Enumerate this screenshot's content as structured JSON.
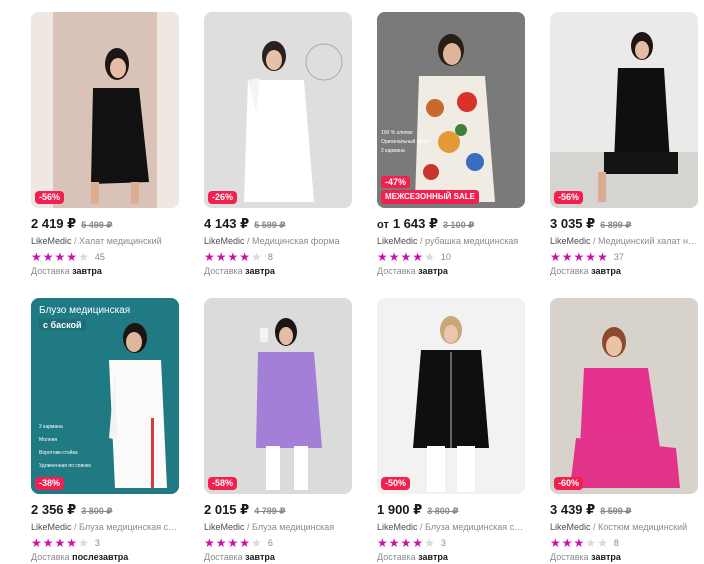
{
  "products": [
    {
      "discount": "-56%",
      "prefix": "",
      "price": "2 419 ₽",
      "old_price": "5 499 ₽",
      "brand": "LikeMedic",
      "name": " / Халат медицинский",
      "stars": 4,
      "reviews": "45",
      "delivery_label": "Доставка",
      "delivery_day": "завтра"
    },
    {
      "discount": "-26%",
      "prefix": "",
      "price": "4 143 ₽",
      "old_price": "5 599 ₽",
      "brand": "LikeMedic",
      "name": " / Медицинская форма",
      "stars": 4,
      "reviews": "8",
      "delivery_label": "Доставка",
      "delivery_day": "завтра"
    },
    {
      "discount": "-47%",
      "promo": "МЕЖСЕЗОННЫЙ SALE",
      "features": [
        "100 % хлопок",
        "Оригинальный принт",
        "2 кармана"
      ],
      "prefix": "от",
      "price": "1 643 ₽",
      "old_price": "3 100 ₽",
      "brand": "LikeMedic",
      "name": " / рубашка медицинская",
      "stars": 4,
      "reviews": "10",
      "delivery_label": "Доставка",
      "delivery_day": "завтра"
    },
    {
      "discount": "-56%",
      "prefix": "",
      "price": "3 035 ₽",
      "old_price": "6 899 ₽",
      "brand": "LikeMedic",
      "name": " / Медицинский халат на ...",
      "stars": 5,
      "reviews": "37",
      "delivery_label": "Доставка",
      "delivery_day": "завтра"
    },
    {
      "discount": "-38%",
      "banner_title": "Блузо медицинская",
      "banner_sub": "с баской",
      "features": [
        "2 кармана",
        "Молния",
        "Воротник-стойка",
        "Удлиненная по спинке"
      ],
      "prefix": "",
      "price": "2 356 ₽",
      "old_price": "3 800 ₽",
      "brand": "LikeMedic",
      "name": " / Блуза медицинская с м...",
      "stars": 4,
      "reviews": "3",
      "delivery_label": "Доставка",
      "delivery_day": "послезавтра"
    },
    {
      "discount": "-58%",
      "prefix": "",
      "price": "2 015 ₽",
      "old_price": "4 799 ₽",
      "brand": "LikeMedic",
      "name": " / Блуза медицинская",
      "stars": 4,
      "reviews": "6",
      "delivery_label": "Доставка",
      "delivery_day": "завтра"
    },
    {
      "discount": "-50%",
      "prefix": "",
      "price": "1 900 ₽",
      "old_price": "3 800 ₽",
      "brand": "LikeMedic",
      "name": " / Блуза медицинская с м...",
      "stars": 4,
      "reviews": "3",
      "delivery_label": "Доставка",
      "delivery_day": "завтра"
    },
    {
      "discount": "-60%",
      "prefix": "",
      "price": "3 439 ₽",
      "old_price": "8 599 ₽",
      "brand": "LikeMedic",
      "name": " / Костюм медицинский",
      "stars": 3,
      "reviews": "8",
      "delivery_label": "Доставка",
      "delivery_day": "завтра"
    }
  ],
  "colors": {
    "star": "#cb11ab",
    "badge": "#f1204e"
  }
}
